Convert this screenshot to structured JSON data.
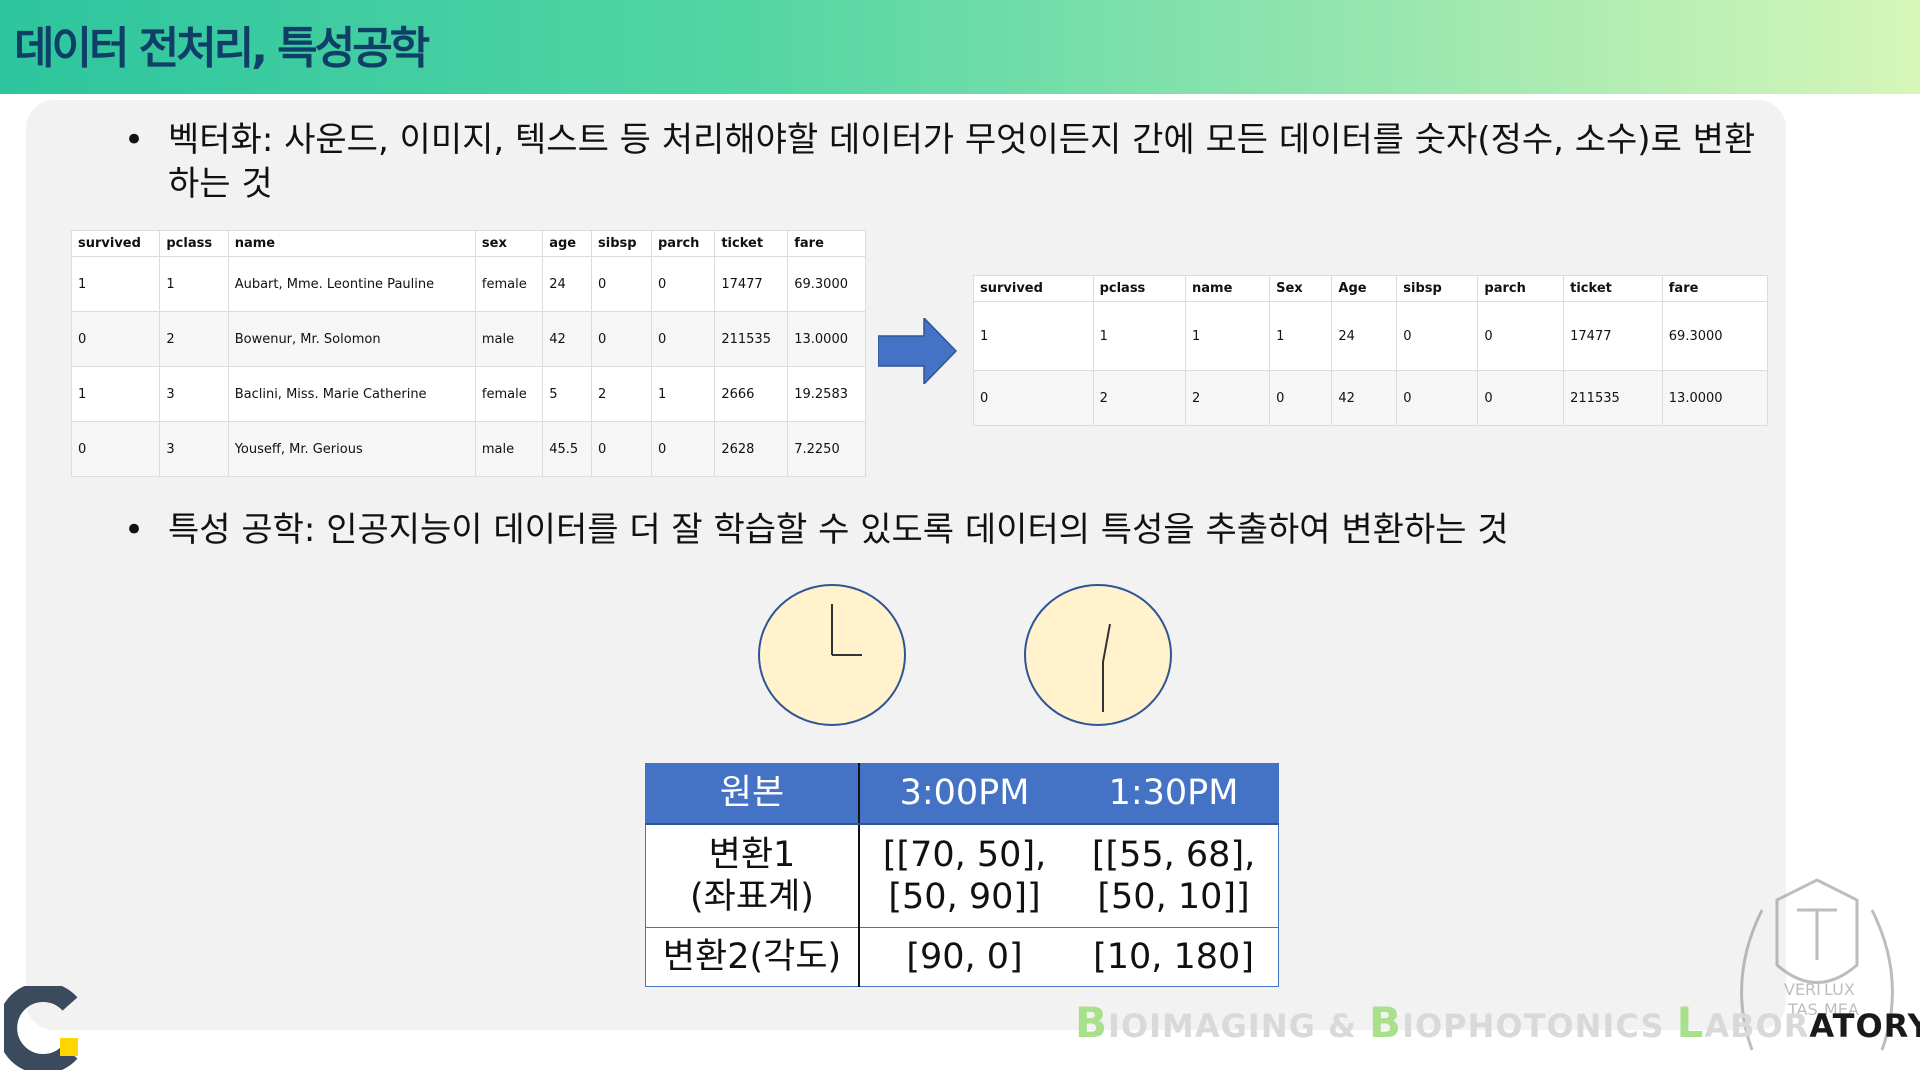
{
  "header": {
    "title": "데이터 전처리, 특성공학"
  },
  "bullets": {
    "vectorization": "벡터화: 사운드, 이미지, 텍스트 등 처리해야할 데이터가 무엇이든지 간에 모든 데이터를 숫자(정수, 소수)로 변환하는 것",
    "feature_engineering": "특성 공학: 인공지능이 데이터를 더 잘 학습할 수 있도록 데이터의 특성을 추출하여 변환하는 것",
    "marker": "•"
  },
  "raw_table": {
    "columns": [
      "survived",
      "pclass",
      "name",
      "sex",
      "age",
      "sibsp",
      "parch",
      "ticket",
      "fare"
    ],
    "rows": [
      [
        "1",
        "1",
        "Aubart, Mme. Leontine Pauline",
        "female",
        "24",
        "0",
        "0",
        "17477",
        "69.3000"
      ],
      [
        "0",
        "2",
        "Bowenur, Mr. Solomon",
        "male",
        "42",
        "0",
        "0",
        "211535",
        "13.0000"
      ],
      [
        "1",
        "3",
        "Baclini, Miss. Marie Catherine",
        "female",
        "5",
        "2",
        "1",
        "2666",
        "19.2583"
      ],
      [
        "0",
        "3",
        "Youseff, Mr. Gerious",
        "male",
        "45.5",
        "0",
        "0",
        "2628",
        "7.2250"
      ]
    ]
  },
  "encoded_table": {
    "columns": [
      "survived",
      "pclass",
      "name",
      "Sex",
      "Age",
      "sibsp",
      "parch",
      "ticket",
      "fare"
    ],
    "rows": [
      [
        "1",
        "1",
        "1",
        "1",
        "24",
        "0",
        "0",
        "17477",
        "69.3000"
      ],
      [
        "0",
        "2",
        "2",
        "0",
        "42",
        "0",
        "0",
        "211535",
        "13.0000"
      ]
    ]
  },
  "time_table": {
    "headers": [
      "원본",
      "3:00PM",
      "1:30PM"
    ],
    "rows": [
      [
        "변환1\n(좌표계)",
        "[[70, 50],\n[50, 90]]",
        "[[55, 68],\n[50, 10]]"
      ],
      [
        "변환2(각도)",
        "[90, 0]",
        "[10, 180]"
      ]
    ]
  },
  "footer": {
    "lab_parts": [
      {
        "t": "B",
        "c": "cap"
      },
      {
        "t": "IOIMAGING & ",
        "c": "faded"
      },
      {
        "t": "B",
        "c": "cap"
      },
      {
        "t": "IOPHOTONICS ",
        "c": "faded"
      },
      {
        "t": "L",
        "c": "cap"
      },
      {
        "t": "ABOR",
        "c": "faded"
      },
      {
        "t": "ATORY",
        "c": "dark"
      }
    ],
    "crest_text": [
      "VERI",
      "LUX",
      "TAS",
      "MEA"
    ]
  },
  "colors": {
    "table_header": "#4472c4",
    "arrow": "#4472c4",
    "clock_face": "#fff2cc",
    "clock_border": "#2f5597"
  }
}
